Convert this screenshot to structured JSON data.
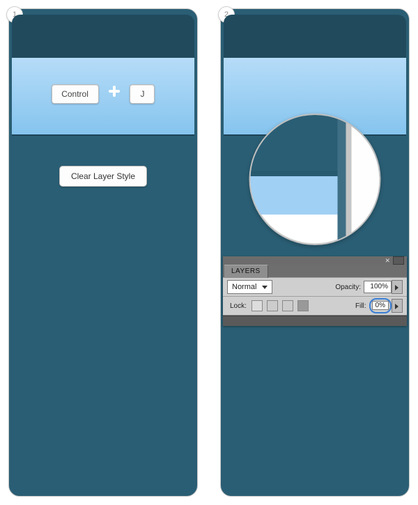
{
  "steps": {
    "one": "1",
    "two": "2"
  },
  "keyboard": {
    "ctrl": "Control",
    "j": "J",
    "plus_icon": "plus-icon"
  },
  "menu": {
    "clear_layer_style": "Clear Layer Style"
  },
  "layers_panel": {
    "tab": "LAYERS",
    "close": "✕",
    "blend_mode": "Normal",
    "opacity_label": "Opacity:",
    "opacity_value": "100%",
    "lock_label": "Lock:",
    "fill_label": "Fill:",
    "fill_value": "0%"
  }
}
